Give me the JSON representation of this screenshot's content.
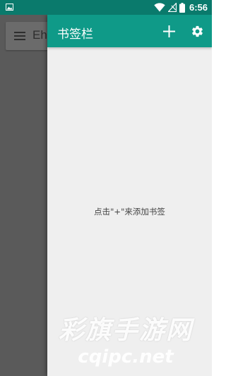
{
  "status_bar": {
    "time": "6:56",
    "icons": [
      "image-icon",
      "wifi-icon",
      "no-signal-icon",
      "battery-icon"
    ]
  },
  "background_app": {
    "title_partial": "Eh",
    "menu_icon": "menu-icon"
  },
  "drawer": {
    "title": "书签栏",
    "add_icon": "plus-icon",
    "settings_icon": "gear-icon",
    "empty_hint": "点击\"+\"来添加书签"
  },
  "watermark": {
    "line1": "彩旗手游网",
    "line2": "cqipc.net"
  },
  "colors": {
    "status_bar": "#0a7a6c",
    "toolbar": "#0f9a88",
    "drawer_bg": "#efefef",
    "scrim": "#5a5a5a"
  }
}
